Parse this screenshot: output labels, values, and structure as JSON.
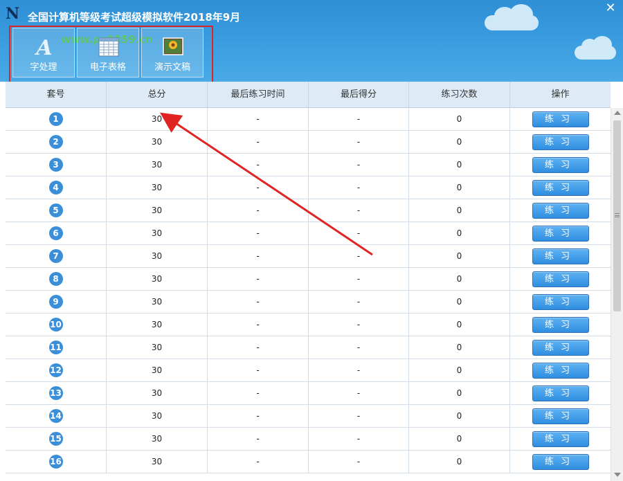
{
  "app": {
    "title": "全国计算机等级考试超级模拟软件2018年9月",
    "watermark": "www.pc0359.cn"
  },
  "toolbar": [
    {
      "label": "字处理",
      "icon": "word-processing-icon"
    },
    {
      "label": "电子表格",
      "icon": "spreadsheet-icon"
    },
    {
      "label": "演示文稿",
      "icon": "presentation-icon"
    }
  ],
  "table": {
    "headers": [
      "套号",
      "总分",
      "最后练习时间",
      "最后得分",
      "练习次数",
      "操作"
    ],
    "rows": [
      {
        "no": "1",
        "score": "30",
        "last_time": "-",
        "last_score": "-",
        "count": "0",
        "action": "练习"
      },
      {
        "no": "2",
        "score": "30",
        "last_time": "-",
        "last_score": "-",
        "count": "0",
        "action": "练习"
      },
      {
        "no": "3",
        "score": "30",
        "last_time": "-",
        "last_score": "-",
        "count": "0",
        "action": "练习"
      },
      {
        "no": "4",
        "score": "30",
        "last_time": "-",
        "last_score": "-",
        "count": "0",
        "action": "练习"
      },
      {
        "no": "5",
        "score": "30",
        "last_time": "-",
        "last_score": "-",
        "count": "0",
        "action": "练习"
      },
      {
        "no": "6",
        "score": "30",
        "last_time": "-",
        "last_score": "-",
        "count": "0",
        "action": "练习"
      },
      {
        "no": "7",
        "score": "30",
        "last_time": "-",
        "last_score": "-",
        "count": "0",
        "action": "练习"
      },
      {
        "no": "8",
        "score": "30",
        "last_time": "-",
        "last_score": "-",
        "count": "0",
        "action": "练习"
      },
      {
        "no": "9",
        "score": "30",
        "last_time": "-",
        "last_score": "-",
        "count": "0",
        "action": "练习"
      },
      {
        "no": "10",
        "score": "30",
        "last_time": "-",
        "last_score": "-",
        "count": "0",
        "action": "练习"
      },
      {
        "no": "11",
        "score": "30",
        "last_time": "-",
        "last_score": "-",
        "count": "0",
        "action": "练习"
      },
      {
        "no": "12",
        "score": "30",
        "last_time": "-",
        "last_score": "-",
        "count": "0",
        "action": "练习"
      },
      {
        "no": "13",
        "score": "30",
        "last_time": "-",
        "last_score": "-",
        "count": "0",
        "action": "练习"
      },
      {
        "no": "14",
        "score": "30",
        "last_time": "-",
        "last_score": "-",
        "count": "0",
        "action": "练习"
      },
      {
        "no": "15",
        "score": "30",
        "last_time": "-",
        "last_score": "-",
        "count": "0",
        "action": "练习"
      },
      {
        "no": "16",
        "score": "30",
        "last_time": "-",
        "last_score": "-",
        "count": "0",
        "action": "练习"
      }
    ]
  },
  "colors": {
    "header_bg": "#3b9ee0",
    "button_blue": "#2f8ee0",
    "annotation_red": "#e02424"
  }
}
